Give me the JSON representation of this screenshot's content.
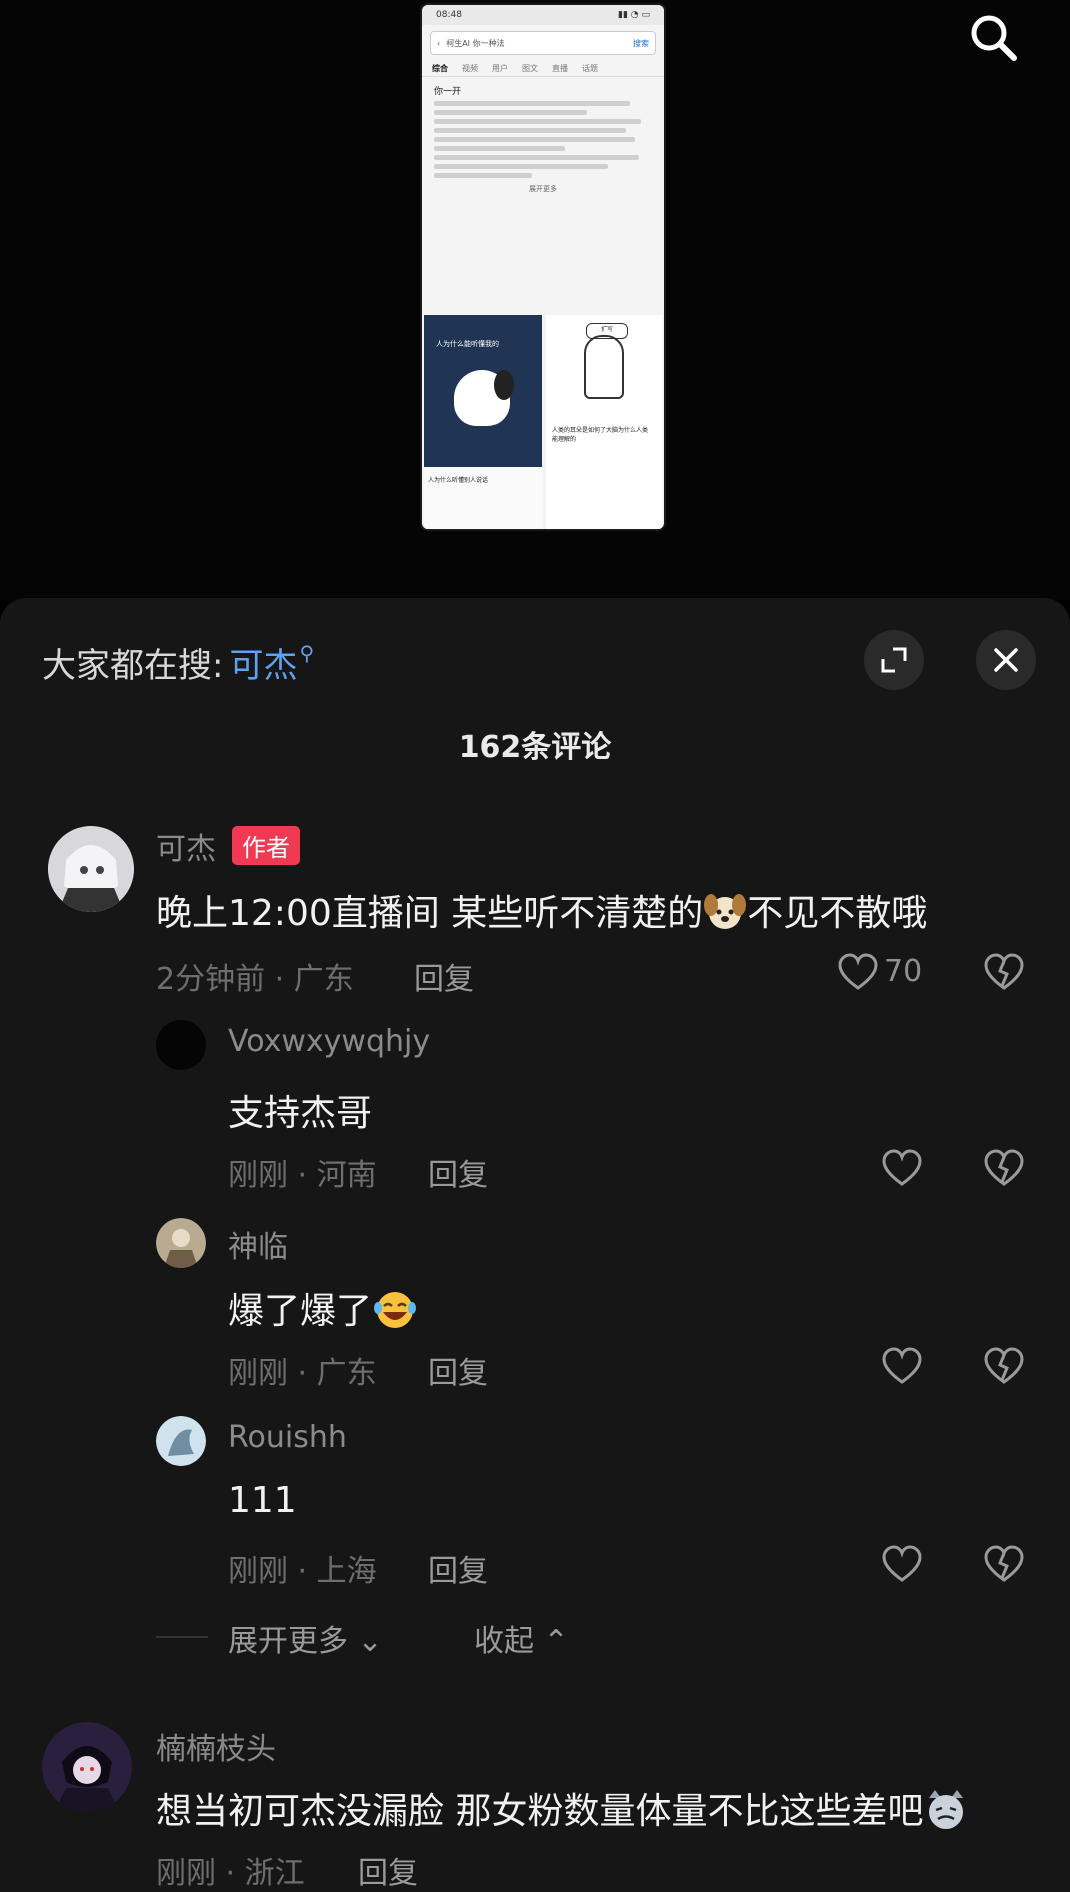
{
  "video": {
    "phone_status_time": "08:48",
    "phone_search_text": "柯生AI 你一种法",
    "phone_search_button": "搜索",
    "phone_tabs": [
      "综合",
      "视频",
      "用户",
      "图文",
      "直播",
      "话题"
    ],
    "phone_heading": "你一开",
    "phone_more": "展开更多",
    "card1_title": "人为什么能听懂我的",
    "card1_caption": "人为什么听懂别人说话",
    "card2_bubble": "扩写",
    "card2_caption": "人类的耳朵是如何了大脑为什么人类能理解的"
  },
  "panel": {
    "trending_label": "大家都在搜:",
    "trending_keyword": "可杰",
    "comment_count": "162条评论"
  },
  "comments": {
    "c1": {
      "username": "可杰",
      "badge": "作者",
      "text": "晚上12:00直播间 某些听不清楚的",
      "text_tail": "不见不散哦",
      "time_loc": "2分钟前 · 广东",
      "reply_label": "回复",
      "likes": "70"
    },
    "r1": {
      "username": "Voxwxywqhjy",
      "text": "支持杰哥",
      "time_loc": "刚刚 · 河南",
      "reply_label": "回复"
    },
    "r2": {
      "username": "神临",
      "text": "爆了爆了",
      "time_loc": "刚刚 · 广东",
      "reply_label": "回复"
    },
    "r3": {
      "username": "Rouishh",
      "text": "111",
      "time_loc": "刚刚 · 上海",
      "reply_label": "回复"
    },
    "expand_more": "展开更多",
    "collapse": "收起",
    "c2": {
      "username": "楠楠枝头",
      "text": "想当初可杰没漏脸 那女粉数量体量不比这些差吧",
      "time_loc": "刚刚 · 浙江",
      "reply_label": "回复"
    }
  },
  "colors": {
    "accent_blue": "#5fa2ee",
    "author_badge": "#f03a54",
    "panel_bg": "#161616"
  }
}
